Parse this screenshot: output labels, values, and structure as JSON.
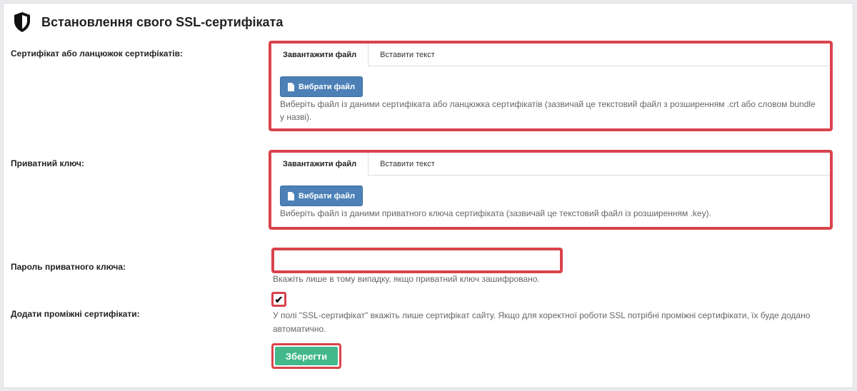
{
  "header": {
    "title": "Встановлення свого SSL-сертифіката",
    "icon": "shield-icon"
  },
  "certificate": {
    "label": "Сертифікат або ланцюжок сертифікатів:",
    "tabs": [
      "Завантажити файл",
      "Вставити текст"
    ],
    "active_tab": 0,
    "button": "Вибрати файл",
    "hint": "Виберіть файл із даними сертифіката або ланцюжка сертифікатів (зазвичай це текстовий файл з розширенням .crt або словом bundle у назві)."
  },
  "private_key": {
    "label": "Приватний ключ:",
    "tabs": [
      "Завантажити файл",
      "Вставити текст"
    ],
    "active_tab": 0,
    "button": "Вибрати файл",
    "hint": "Виберіть файл із даними приватного ключа сертифіката (зазвичай це текстовий файл із розширенням .key)."
  },
  "password": {
    "label": "Пароль приватного ключа:",
    "value": "",
    "hint": "Вкажіть лише в тому випадку, якщо приватний ключ зашифровано."
  },
  "intermediate": {
    "label": "Додати проміжні сертифікати:",
    "checked": true,
    "hint": "У полі \"SSL-сертифікат\" вкажіть лише сертифікат сайту. Якщо для коректної роботи SSL потрібні проміжні сертифікати, їх буде додано автоматично."
  },
  "save_button": "Зберегти",
  "colors": {
    "highlight": "#d9434b",
    "primary": "#4c80b7",
    "save": "#42b88b"
  }
}
